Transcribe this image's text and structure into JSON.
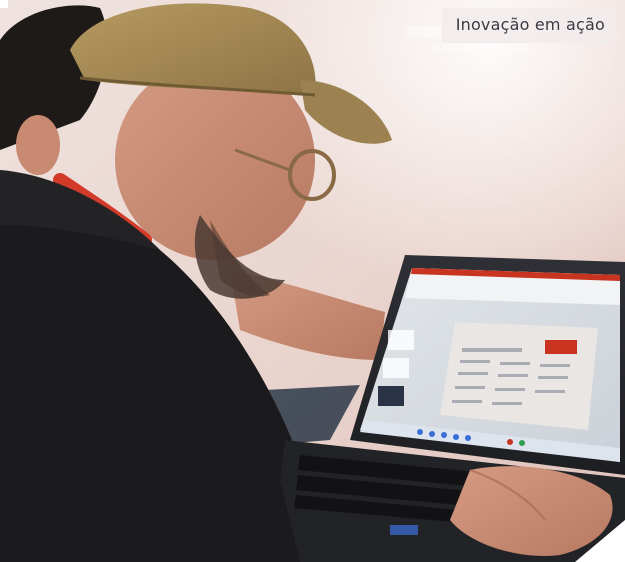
{
  "caption": {
    "text": "Inovação em ação"
  },
  "photo": {
    "subject": "man-with-cap-using-laptop",
    "palette": {
      "wall": "#e8d6d0",
      "shirt": "#1b1b1d",
      "cap": "#a98c55",
      "laptop": "#2a2b30",
      "screen": "#d9dde3",
      "accent": "#c8341f"
    }
  }
}
